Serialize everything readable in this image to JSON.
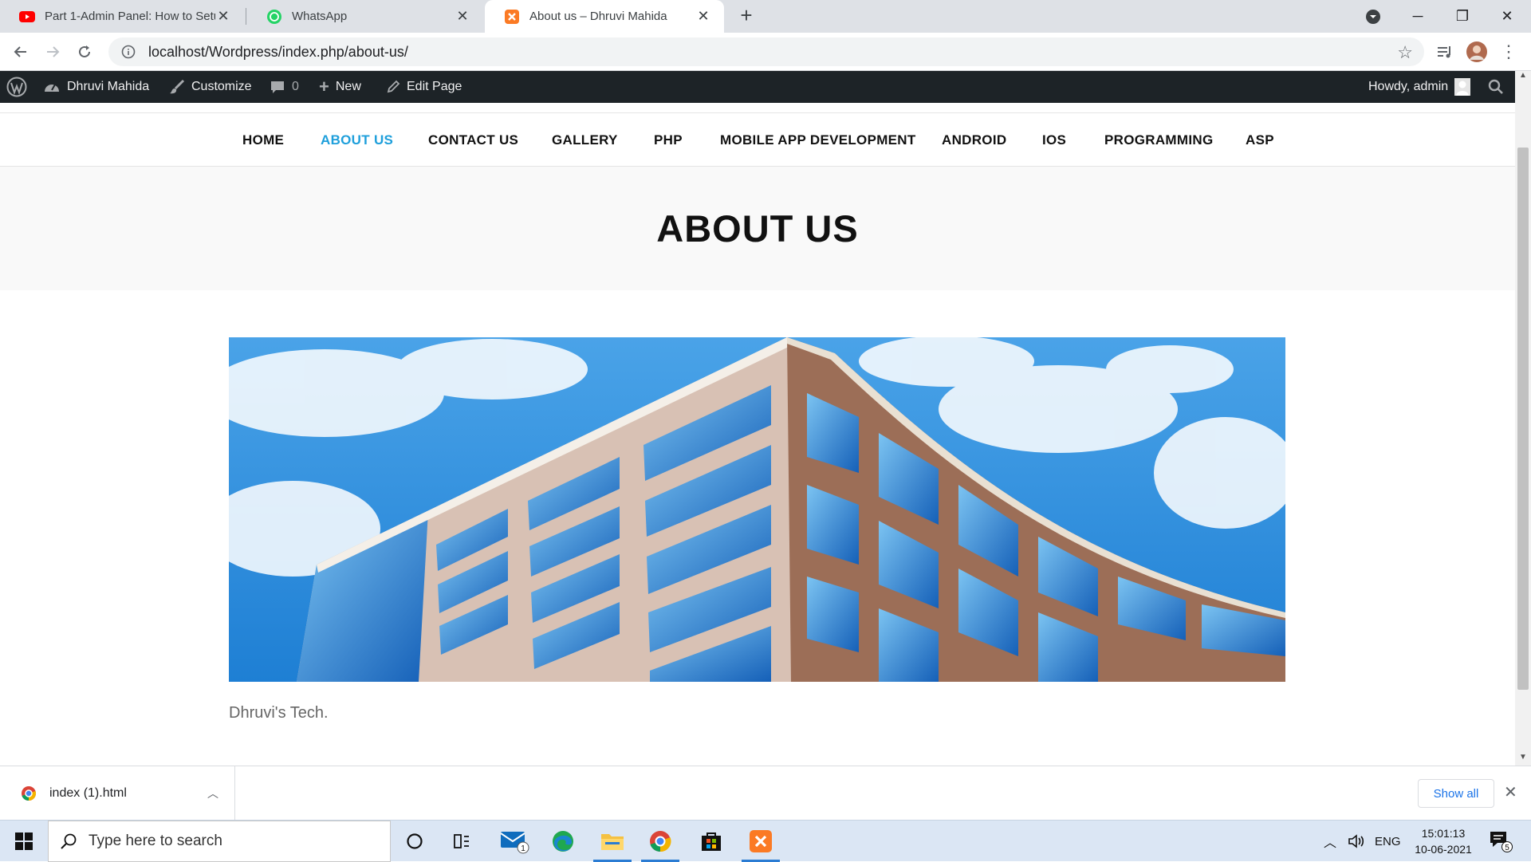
{
  "browser": {
    "tabs": [
      {
        "title": "Part 1-Admin Panel: How to Setu",
        "icon": "youtube-icon",
        "active": false
      },
      {
        "title": "WhatsApp",
        "icon": "whatsapp-icon",
        "active": false
      },
      {
        "title": "About us – Dhruvi Mahida",
        "icon": "xampp-icon",
        "active": true
      }
    ],
    "url": "localhost/Wordpress/index.php/about-us/"
  },
  "admin_bar": {
    "site_name": "Dhruvi Mahida",
    "customize": "Customize",
    "comments_count": "0",
    "new_label": "New",
    "edit_page": "Edit Page",
    "howdy": "Howdy, admin"
  },
  "site": {
    "nav": [
      {
        "label": "HOME",
        "current": false
      },
      {
        "label": "ABOUT US",
        "current": true
      },
      {
        "label": "CONTACT US",
        "current": false
      },
      {
        "label": "GALLERY",
        "current": false
      },
      {
        "label": "PHP",
        "current": false
      },
      {
        "label": "MOBILE APP DEVELOPMENT",
        "current": false
      },
      {
        "label": "ANDROID",
        "current": false
      },
      {
        "label": "IOS",
        "current": false
      },
      {
        "label": "PROGRAMMING",
        "current": false
      },
      {
        "label": "ASP",
        "current": false
      }
    ],
    "page_title": "ABOUT US",
    "caption": "Dhruvi's Tech."
  },
  "downloads": {
    "file_name": "index (1).html",
    "show_all": "Show all"
  },
  "taskbar": {
    "search_placeholder": "Type here to search",
    "mail_badge": "1",
    "language": "ENG",
    "time": "15:01:13",
    "date": "10-06-2021",
    "notification_count": "5"
  },
  "colors": {
    "accent": "#1e9fdb",
    "admin_bar": "#1d2327",
    "tab_strip": "#dee1e6"
  }
}
